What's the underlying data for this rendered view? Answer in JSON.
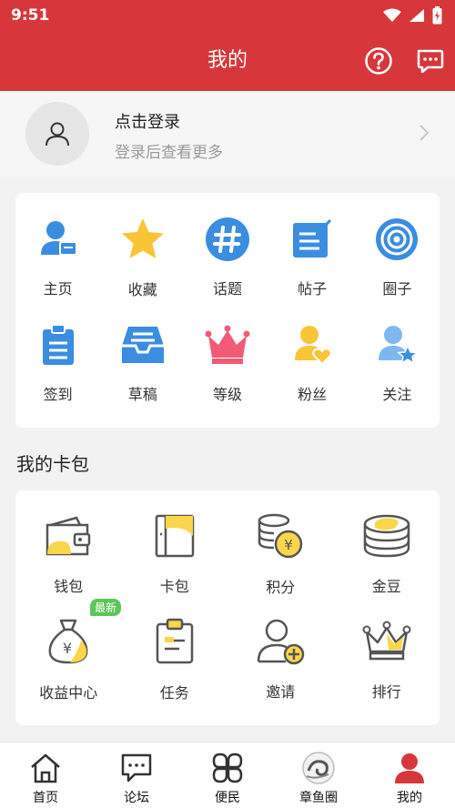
{
  "status_bar": {
    "time": "9:51"
  },
  "header": {
    "title": "我的"
  },
  "login": {
    "title": "点击登录",
    "subtitle": "登录后查看更多"
  },
  "quick_menu": [
    {
      "label": "主页",
      "icon": "user-card-icon"
    },
    {
      "label": "收藏",
      "icon": "star-icon"
    },
    {
      "label": "话题",
      "icon": "hashtag-icon"
    },
    {
      "label": "帖子",
      "icon": "edit-note-icon"
    },
    {
      "label": "圈子",
      "icon": "target-circle-icon"
    },
    {
      "label": "签到",
      "icon": "clipboard-icon"
    },
    {
      "label": "草稿",
      "icon": "inbox-tray-icon"
    },
    {
      "label": "等级",
      "icon": "crown-icon"
    },
    {
      "label": "粉丝",
      "icon": "user-heart-icon"
    },
    {
      "label": "关注",
      "icon": "user-star-icon"
    }
  ],
  "card_pack": {
    "title": "我的卡包",
    "items": [
      {
        "label": "钱包",
        "icon": "wallet-icon"
      },
      {
        "label": "卡包",
        "icon": "card-holder-icon"
      },
      {
        "label": "积分",
        "icon": "coins-yen-icon"
      },
      {
        "label": "金豆",
        "icon": "coin-stack-icon"
      },
      {
        "label": "收益中心",
        "icon": "money-bag-icon",
        "badge": "最新"
      },
      {
        "label": "任务",
        "icon": "task-clipboard-icon"
      },
      {
        "label": "邀请",
        "icon": "invite-user-icon"
      },
      {
        "label": "排行",
        "icon": "ranking-crown-icon"
      }
    ]
  },
  "tabs": [
    {
      "label": "首页",
      "icon": "home-icon"
    },
    {
      "label": "论坛",
      "icon": "chat-icon"
    },
    {
      "label": "便民",
      "icon": "clover-icon"
    },
    {
      "label": "章鱼圈",
      "icon": "octopus-logo-icon"
    },
    {
      "label": "我的",
      "icon": "profile-icon",
      "active": true
    }
  ],
  "colors": {
    "brand": "#d7373a",
    "blue": "#3a8de0",
    "yellow": "#f9c536",
    "gray": "#f2f2f2"
  }
}
